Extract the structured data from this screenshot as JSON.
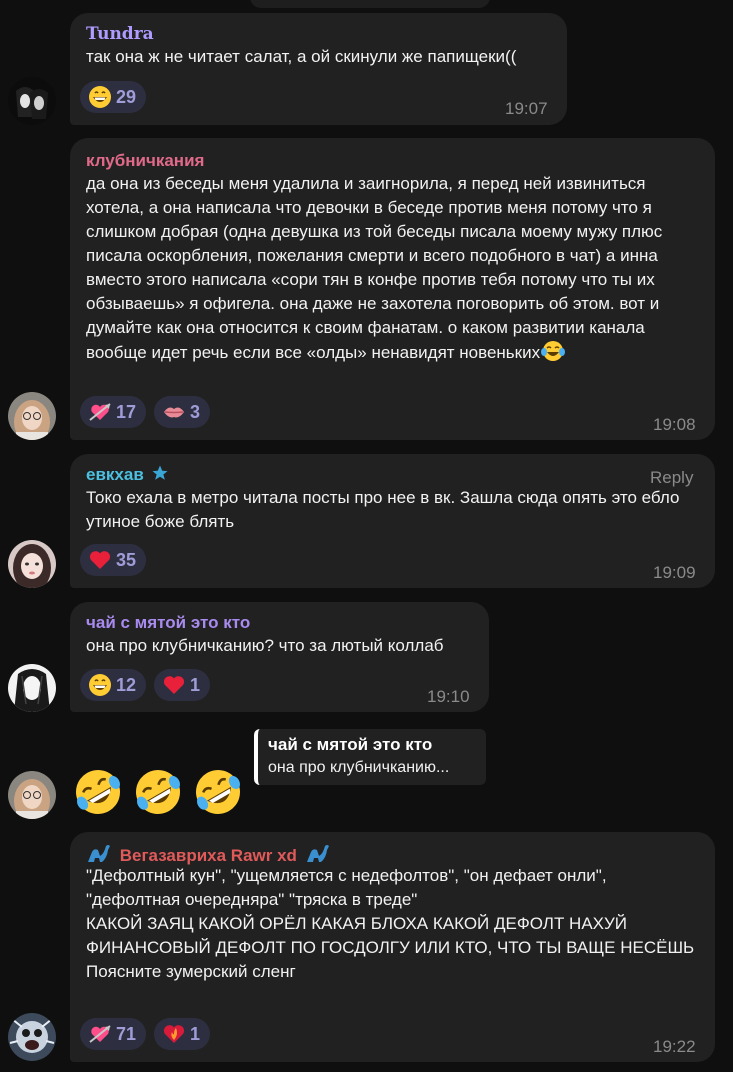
{
  "messages": [
    {
      "author": "Tundra",
      "author_color": "#b09cff",
      "text": "так она ж не читает салат, а ой скинули же папищеки((",
      "time": "19:07",
      "reactions": [
        {
          "emoji": "grin",
          "count": "29"
        }
      ]
    },
    {
      "author": "клубничкания",
      "author_color": "#e16a8a",
      "text": "да она из беседы меня удалила и заигнорила, я перед ней извиниться хотела, а она написала что девочки в беседе против меня потому что я слишком добрая (одна девушка из той беседы писала моему мужу плюс писала оскорбления, пожелания смерти и всего подобного в чат) а инна вместо этого написала «сори тян в конфе против тебя потому что ты их обзываешь» я офигела. она даже не захотела поговорить об этом. вот и думайте как она относится к своим фанатам. о каком развитии канала вообще идет речь если все «олды» ненавидят новеньких",
      "time": "19:08",
      "reactions": [
        {
          "emoji": "heart-arrow",
          "count": "17"
        },
        {
          "emoji": "kiss-lips",
          "count": "3"
        }
      ]
    },
    {
      "author": "евкхав",
      "author_color": "#4bc0e0",
      "reply_label": "Reply",
      "text": "Токо ехала в метро читала посты про нее в вк. Зашла сюда опять это ебло утиное боже блять",
      "time": "19:09",
      "reactions": [
        {
          "emoji": "red-heart",
          "count": "35"
        }
      ]
    },
    {
      "author": "чай с мятой это кто",
      "author_color": "#a98bf0",
      "text": "она про клубничканию? что за лютый коллаб",
      "time": "19:10",
      "reactions": [
        {
          "emoji": "grin",
          "count": "12"
        },
        {
          "emoji": "red-heart",
          "count": "1"
        }
      ]
    },
    {
      "quote_author": "чай с мятой это кто",
      "quote_text": "она про клубничканию...",
      "emojis": [
        "rofl",
        "rofl",
        "rofl"
      ]
    },
    {
      "author": "Вегазавриха Rawr xd",
      "author_color": "#e05a5a",
      "text": "\"Дефолтный кун\", \"ущемляется с недефолтов\", \"он дефает онли\", \"дефолтная очередняра\" \"тряска в треде\"\nКАКОЙ ЗАЯЦ КАКОЙ ОРЁЛ КАКАЯ БЛОХА КАКОЙ ДЕФОЛТ НАХУЙ ФИНАНСОВЫЙ ДЕФОЛТ ПО ГОСДОЛГУ ИЛИ КТО, ЧТО ТЫ ВАЩЕ НЕСЁШЬ\nПоясните зумерский сленг",
      "time": "19:22",
      "reactions": [
        {
          "emoji": "heart-arrow",
          "count": "71"
        },
        {
          "emoji": "heart-on-fire",
          "count": "1"
        }
      ]
    }
  ]
}
